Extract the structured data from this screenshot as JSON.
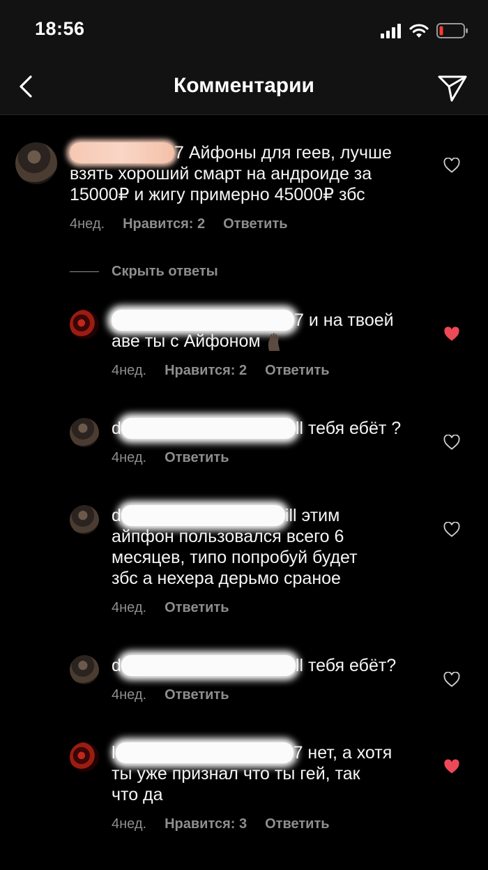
{
  "status_bar": {
    "time": "18:56",
    "icons": [
      "signal-icon",
      "wifi-icon",
      "battery-low-icon"
    ]
  },
  "nav": {
    "title": "Комментарии",
    "back_icon": "chevron-left-icon",
    "send_icon": "send-icon"
  },
  "colors": {
    "background": "#000000",
    "bar": "#121212",
    "meta_gray": "#8e8e8e",
    "liked_heart": "#ed4956"
  },
  "hide_replies_label": "Скрыть ответы",
  "comments": [
    {
      "username_tail": "7",
      "text": "Айфоны для геев, лучше взять хороший смарт на андроиде за 15000₽ и жигу примерно 45000₽ збс",
      "text_line1": " Айфоны для геев, лучше",
      "text_line2": "взять хороший смарт на андроиде за",
      "text_line3": "15000₽ и жигу примерно 45000₽ збс",
      "time": "4нед.",
      "likes": "Нравится: 2",
      "reply": "Ответить",
      "liked": false
    },
    {
      "username_tail": "7",
      "text_line1": " и на твоей",
      "text_line2": "аве ты с Айфоном",
      "emoji": "raised-hand-emoji",
      "time": "4нед.",
      "likes": "Нравится: 2",
      "reply": "Ответить",
      "liked": true
    },
    {
      "username_head": "d",
      "username_tail": "ll",
      "text_line1": " тебя ебёт ?",
      "time": "4нед.",
      "reply": "Ответить",
      "liked": false
    },
    {
      "username_head": "d",
      "username_tail": "ill",
      "text_line1": " этим",
      "text_line2": "айпфон пользовался всего 6",
      "text_line3": "месяцев, типо попробуй будет",
      "text_line4": "збс а нехера дерьмо сраное",
      "time": "4нед.",
      "reply": "Ответить",
      "liked": false
    },
    {
      "username_head": "d",
      "username_tail": "ll",
      "text_line1": " тебя ебёт?",
      "time": "4нед.",
      "reply": "Ответить",
      "liked": false
    },
    {
      "username_head": "l",
      "username_tail": "7",
      "text_line1": " нет, а хотя",
      "text_line2": "ты уже признал что ты гей, так",
      "text_line3": "что да",
      "time": "4нед.",
      "likes": "Нравится: 3",
      "reply": "Ответить",
      "liked": true
    }
  ]
}
